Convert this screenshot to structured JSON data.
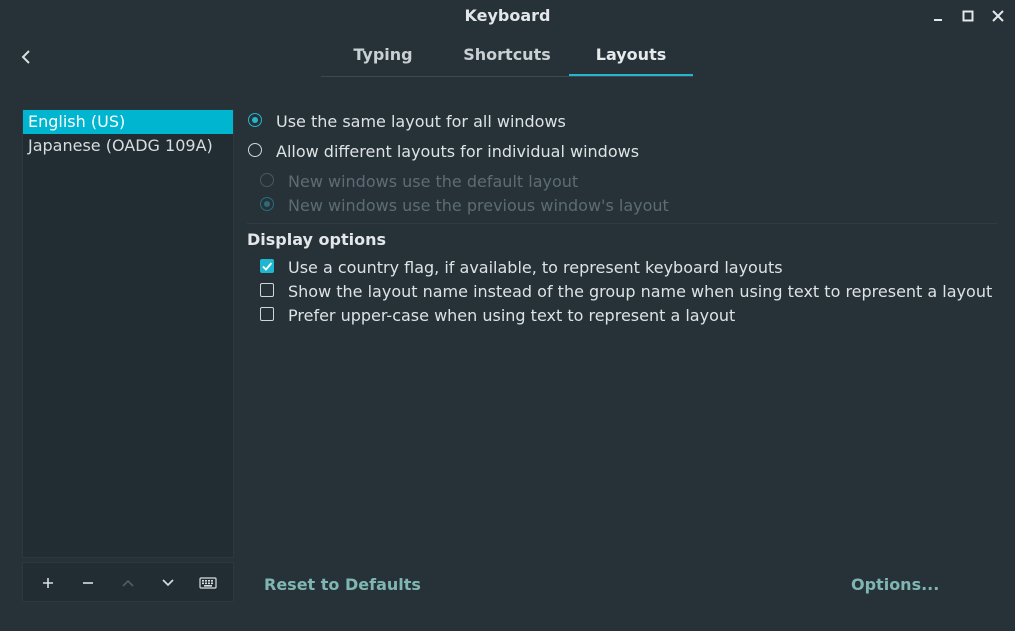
{
  "window": {
    "title": "Keyboard",
    "controls": [
      "minimize-icon",
      "maximize-icon",
      "close-icon"
    ]
  },
  "nav": {
    "back_icon": "chevron-left-icon"
  },
  "tabs": [
    {
      "label": "Typing",
      "active": false
    },
    {
      "label": "Shortcuts",
      "active": false
    },
    {
      "label": "Layouts",
      "active": true
    }
  ],
  "layouts_list": {
    "items": [
      {
        "label": "English (US)",
        "selected": true
      },
      {
        "label": "Japanese (OADG 109A)",
        "selected": false
      }
    ],
    "toolbar": [
      "add-icon",
      "remove-icon",
      "move-up-icon",
      "move-down-icon",
      "keyboard-icon"
    ]
  },
  "layout_mode": {
    "same_for_all": "Use the same layout for all windows",
    "per_window": "Allow different layouts for individual windows",
    "new_default": "New windows use the default layout",
    "new_previous": "New windows use the previous window's layout",
    "selected": "same_for_all"
  },
  "display_options": {
    "title": "Display options",
    "items": [
      {
        "label": "Use a country flag, if available,  to represent keyboard layouts",
        "checked": true
      },
      {
        "label": "Show the layout name instead of the group name when using text to represent a layout",
        "checked": false
      },
      {
        "label": "Prefer upper-case when using text to represent a layout",
        "checked": false
      }
    ]
  },
  "footer": {
    "reset_label": "Reset to Defaults",
    "options_label": "Options..."
  },
  "colors": {
    "background": "#263238",
    "accent": "#26b5cc",
    "selection": "#00b5cf",
    "link": "#7fb6b2"
  }
}
